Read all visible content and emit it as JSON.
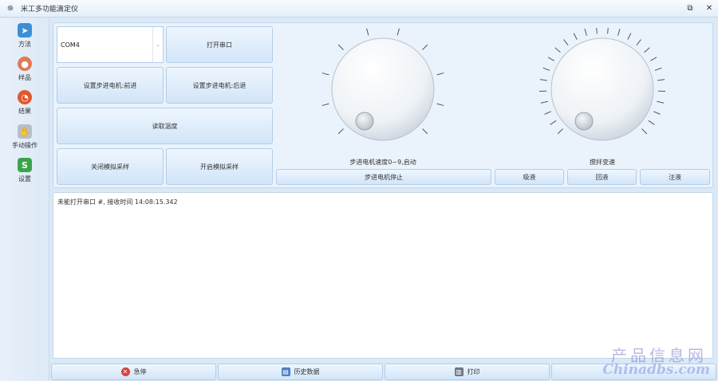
{
  "window": {
    "title": "米工多功能滴定仪",
    "restore_glyph": "⧉",
    "close_glyph": "✕"
  },
  "sidebar": {
    "items": [
      {
        "label": "方法",
        "icon": "paper-plane-icon",
        "color": "#3b8fd6",
        "glyph": "➤"
      },
      {
        "label": "样品",
        "icon": "location-pin-icon",
        "color": "#e07a5a",
        "glyph": "●"
      },
      {
        "label": "结果",
        "icon": "pie-chart-icon",
        "color": "#e2582c",
        "glyph": "◔"
      },
      {
        "label": "手动操作",
        "icon": "hand-icon",
        "color": "#b9bec6",
        "glyph": "✋"
      },
      {
        "label": "设置",
        "icon": "settings-s-icon",
        "color": "#3ba449",
        "glyph": "S"
      }
    ]
  },
  "controls": {
    "port_value": "COM4",
    "combo_arrow": "⌄",
    "open_port": "打开串口",
    "motor_forward": "设置步进电机:前进",
    "motor_backward": "设置步进电机:后退",
    "read_temp": "读取温度",
    "close_sim": "关闭模拟采样",
    "open_sim": "开启模拟采样",
    "motor_stop": "步进电机停止",
    "aspirate": "吸液",
    "return_liquid": "回液",
    "inject": "注液"
  },
  "dials": {
    "motor_speed_label": "步进电机速度0~9,启动",
    "stir_speed_label": "搅拌变速"
  },
  "log": {
    "message": "未能打开串口 #, 接收时间 14:08:15.342"
  },
  "bottom": {
    "emergency_stop": "急停",
    "history": "历史数据",
    "print": "打印"
  },
  "watermark": {
    "cn": "产品信息网",
    "en": "Chinadbs.com"
  }
}
